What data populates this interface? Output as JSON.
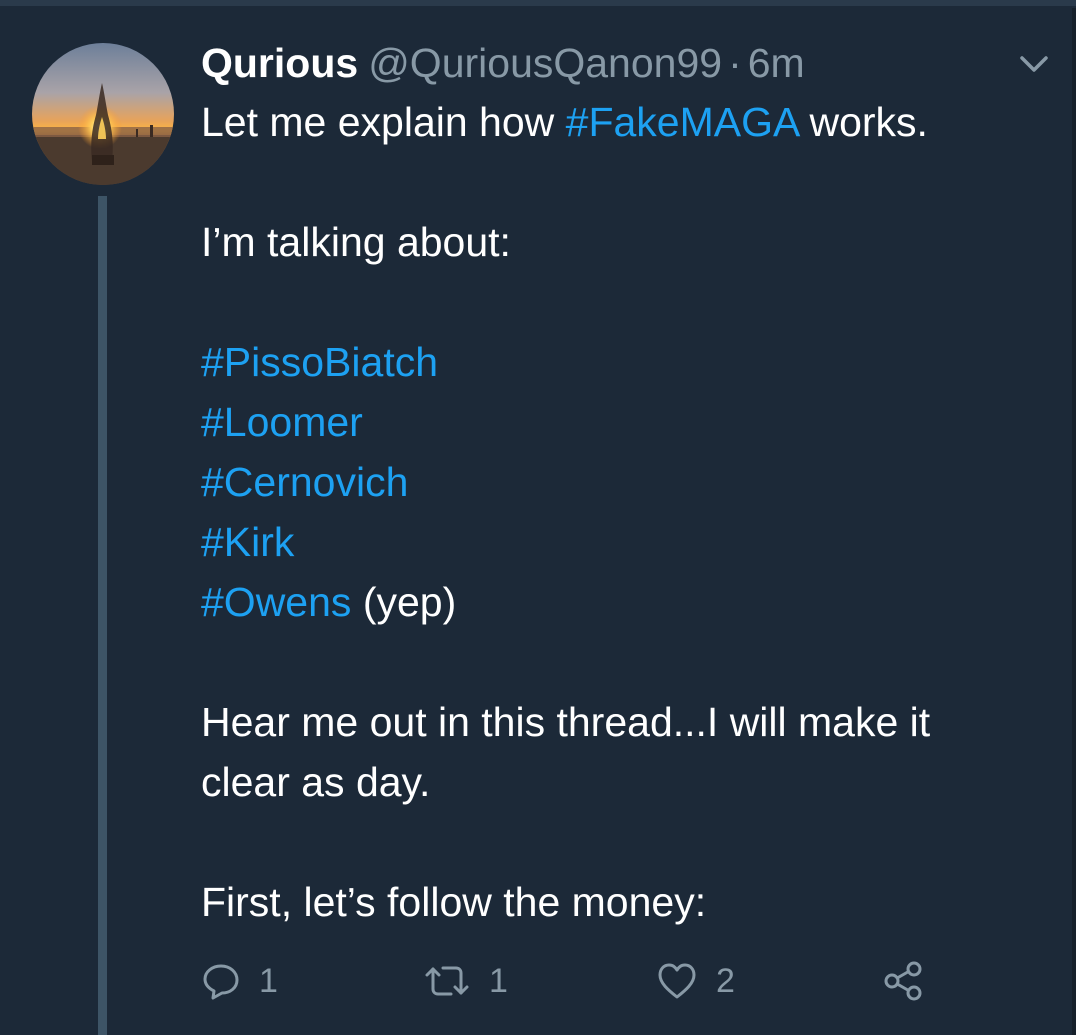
{
  "tweet": {
    "author": {
      "display_name": "Qurious",
      "handle": "@QuriousQanon99",
      "separator": "·",
      "time": "6m"
    },
    "lines": [
      [
        {
          "text": "Let me explain how "
        },
        {
          "text": "#FakeMAGA",
          "hashtag": true
        },
        {
          "text": " works."
        }
      ],
      [],
      [
        {
          "text": "I’m talking about:"
        }
      ],
      [],
      [
        {
          "text": "#PissoBiatch",
          "hashtag": true
        }
      ],
      [
        {
          "text": "#Loomer",
          "hashtag": true
        }
      ],
      [
        {
          "text": "#Cernovich",
          "hashtag": true
        }
      ],
      [
        {
          "text": "#Kirk",
          "hashtag": true
        }
      ],
      [
        {
          "text": "#Owens",
          "hashtag": true
        },
        {
          "text": " (yep)"
        }
      ],
      [],
      [
        {
          "text": "Hear me out in this thread...I will make it"
        }
      ],
      [
        {
          "text": "clear as day."
        }
      ],
      [],
      [
        {
          "text": "First, let’s follow the money:"
        }
      ]
    ],
    "actions": {
      "reply": {
        "icon": "reply-icon",
        "count": "1"
      },
      "retweet": {
        "icon": "retweet-icon",
        "count": "1"
      },
      "like": {
        "icon": "heart-icon",
        "count": "2"
      },
      "share": {
        "icon": "share-icon"
      }
    },
    "menu_icon": "chevron-down-icon"
  },
  "colors": {
    "background": "#1c2938",
    "text": "#ffffff",
    "muted": "#8899a6",
    "hashtag": "#1da1f2",
    "thread_line": "#3d5466"
  }
}
